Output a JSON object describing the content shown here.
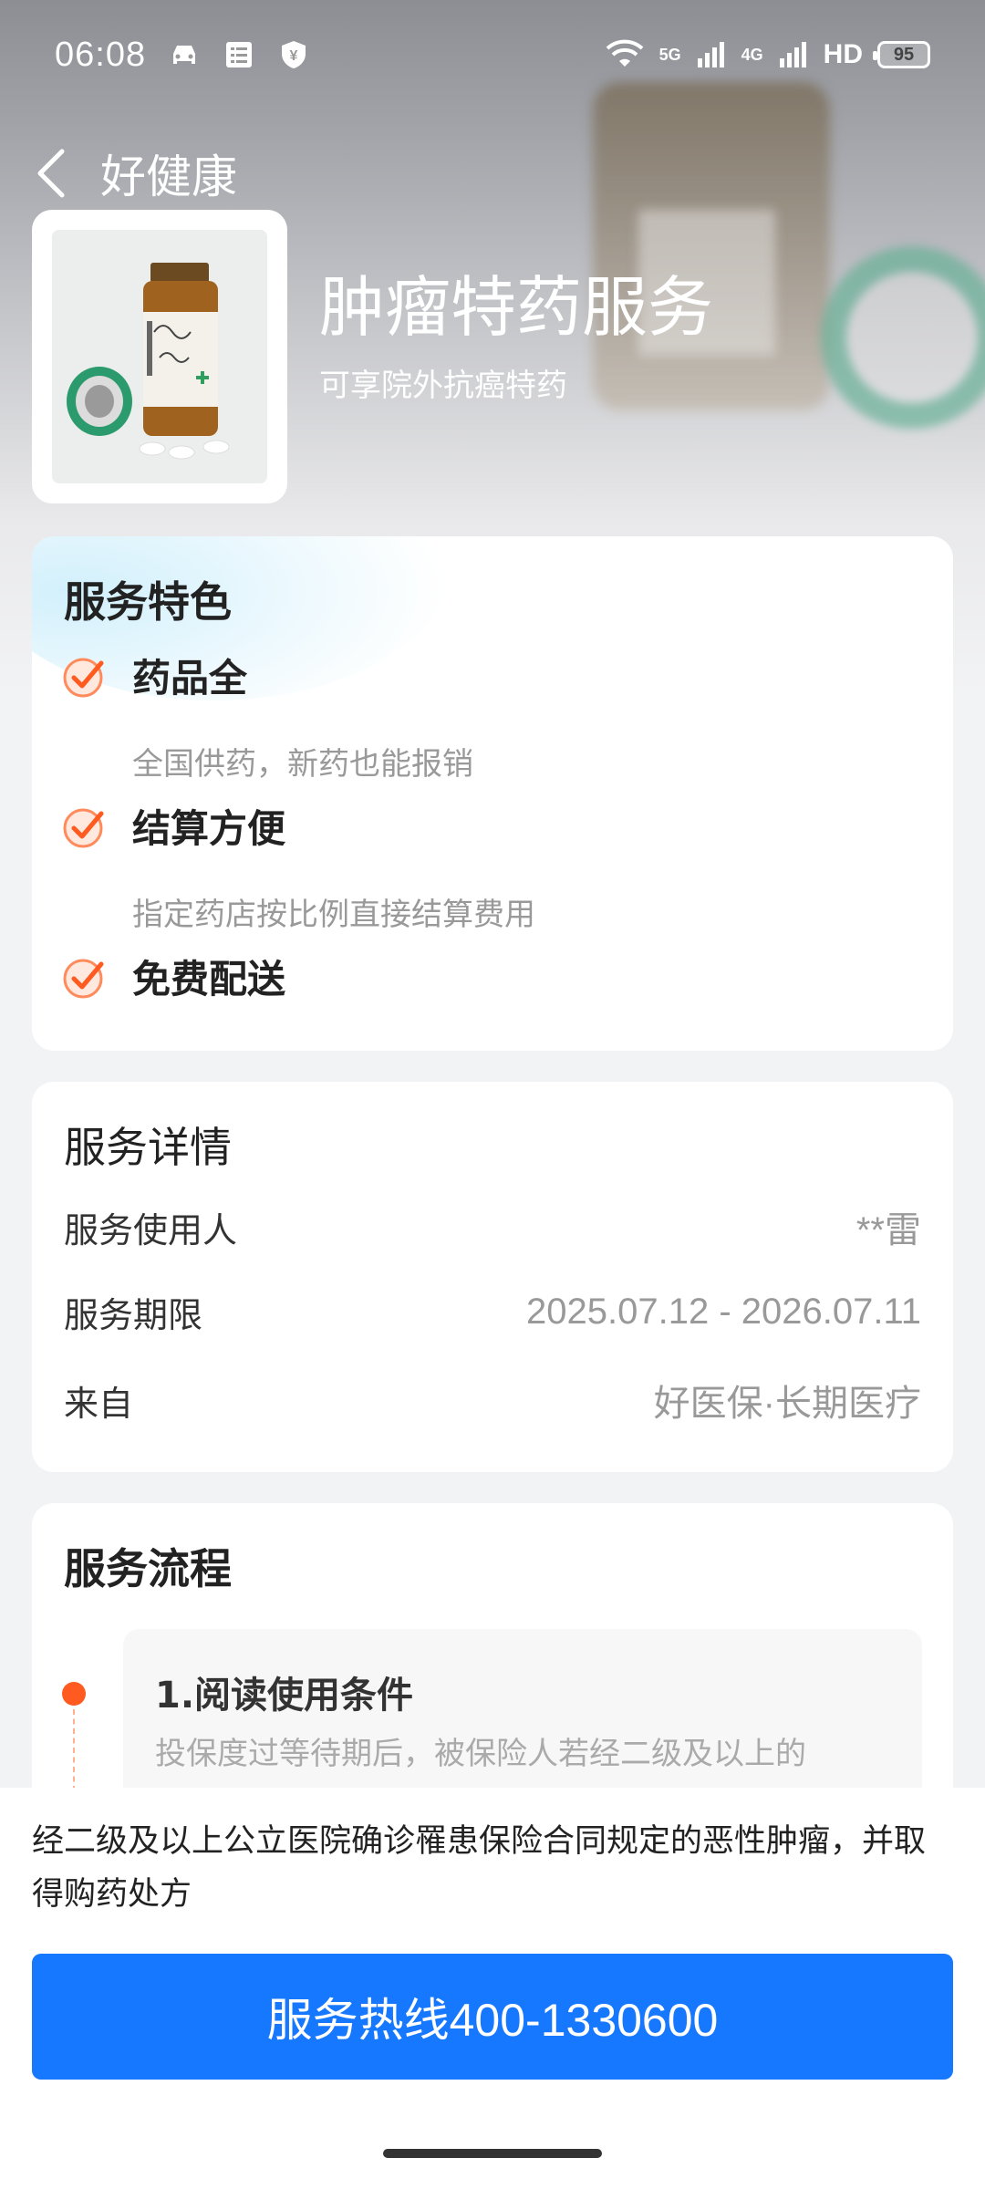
{
  "status_bar": {
    "time": "06:08",
    "network_5g": "5G",
    "network_4g": "4G",
    "hd_label": "HD",
    "battery": "95"
  },
  "nav": {
    "title": "好健康"
  },
  "product": {
    "title": "肿瘤特药服务",
    "subtitle": "可享院外抗癌特药"
  },
  "features": {
    "title": "服务特色",
    "items": [
      {
        "name": "药品全",
        "desc": "全国供药，新药也能报销"
      },
      {
        "name": "结算方便",
        "desc": "指定药店按比例直接结算费用"
      },
      {
        "name": "免费配送",
        "desc": ""
      }
    ]
  },
  "details": {
    "title": "服务详情",
    "rows": [
      {
        "label": "服务使用人",
        "value": "**雷"
      },
      {
        "label": "服务期限",
        "value": "2025.07.12 - 2026.07.11"
      },
      {
        "label": "来自",
        "value": "好医保·长期医疗"
      }
    ]
  },
  "flow": {
    "title": "服务流程",
    "steps": [
      {
        "title": "1.阅读使用条件",
        "text": "投保度过等待期后，被保险人若经二级及以上的"
      }
    ]
  },
  "bottom": {
    "text": "经二级及以上公立医院确诊罹患保险合同规定的恶性肿瘤，并取得购药处方",
    "hotline_label": "服务热线400-1330600"
  },
  "colors": {
    "primary": "#1677ff",
    "accent": "#ff5a1f"
  }
}
